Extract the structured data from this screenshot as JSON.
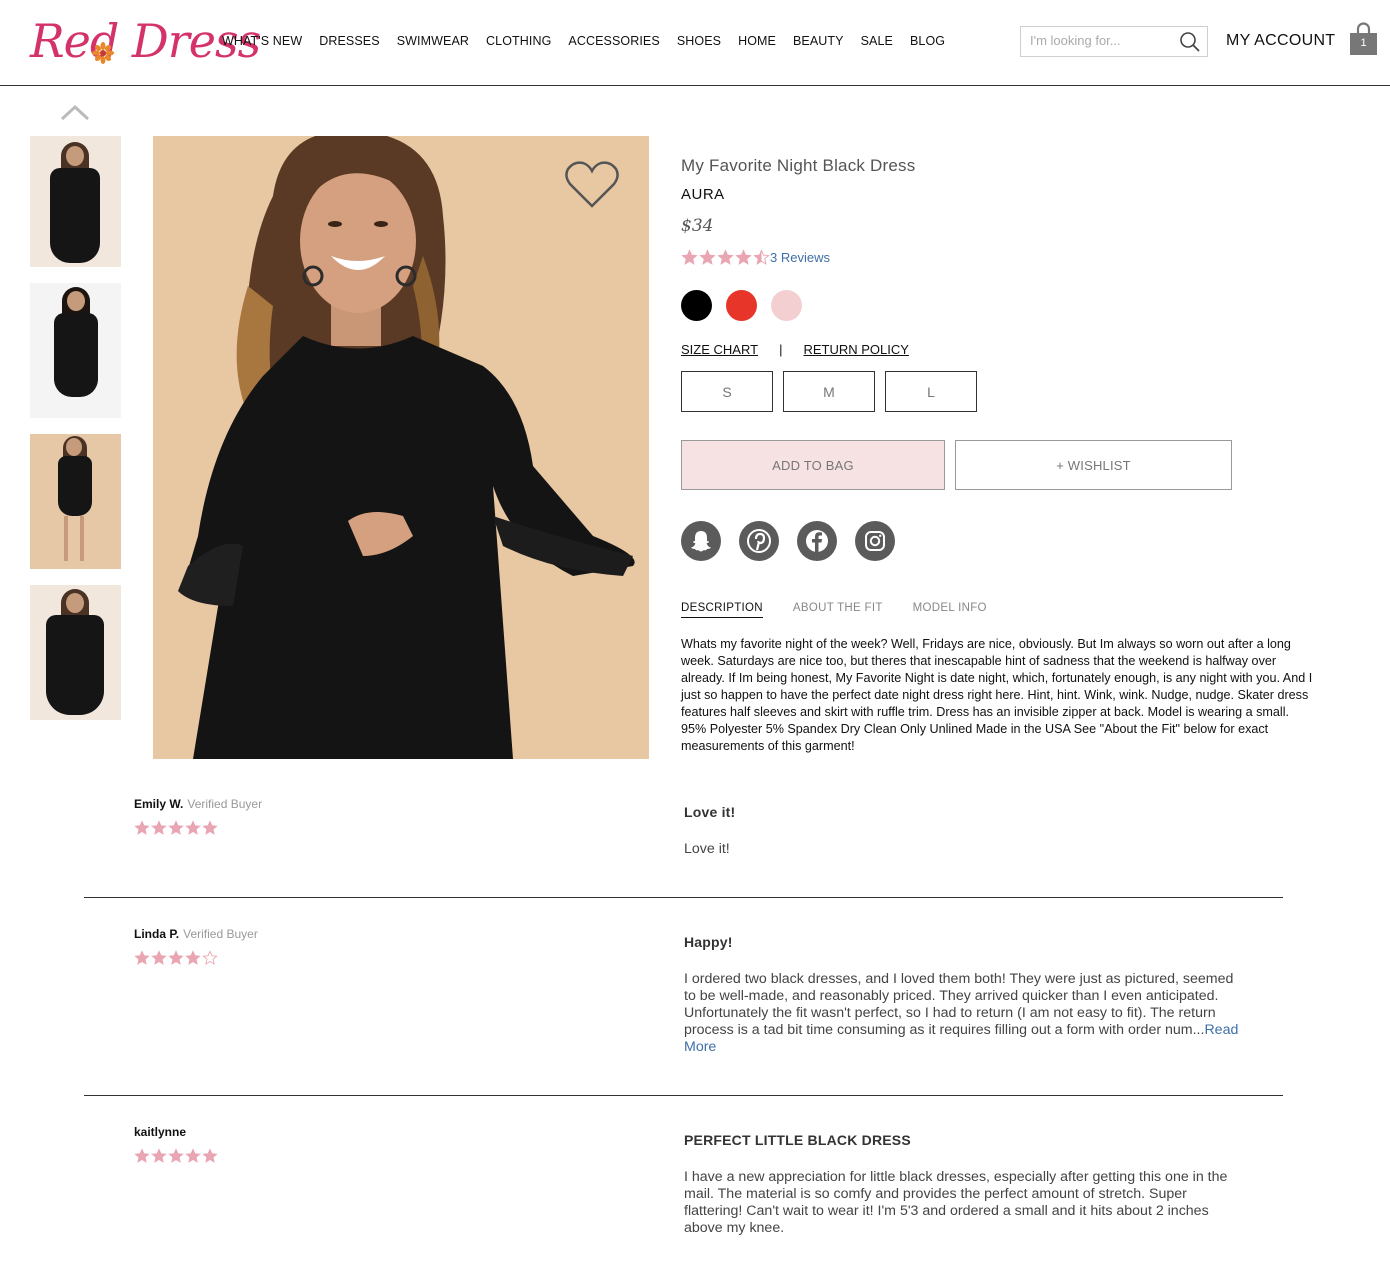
{
  "brand": {
    "logo_text": "Red Dress"
  },
  "nav": {
    "items": [
      "WHAT'S NEW",
      "DRESSES",
      "SWIMWEAR",
      "CLOTHING",
      "ACCESSORIES",
      "SHOES",
      "HOME",
      "BEAUTY",
      "SALE",
      "BLOG"
    ]
  },
  "search": {
    "placeholder": "I'm looking for...",
    "icon": "search-icon"
  },
  "account": {
    "label": "MY ACCOUNT",
    "bag_count": "1"
  },
  "product": {
    "title": "My Favorite Night Black Dress",
    "brand": "AURA",
    "price": "$34",
    "rating": 4.5,
    "reviews_label": "3 Reviews",
    "swatches": [
      "#000000",
      "#e8352a",
      "#f3cfd2"
    ],
    "size_chart": "SIZE CHART",
    "separator": "|",
    "return_policy": "RETURN POLICY",
    "sizes": [
      "S",
      "M",
      "L"
    ],
    "add_to_bag": "ADD TO BAG",
    "wishlist": "+ WISHLIST",
    "social": [
      "snapchat-icon",
      "pinterest-icon",
      "facebook-icon",
      "instagram-icon"
    ],
    "tabs": [
      "DESCRIPTION",
      "ABOUT THE FIT",
      "MODEL INFO"
    ],
    "description": "Whats my favorite night of the week? Well, Fridays are nice, obviously. But Im always so worn out after a long week. Saturdays are nice too, but theres that inescapable hint of sadness that the weekend is halfway over already. If Im being honest, My Favorite Night is date night, which, fortunately enough, is any night with you. And I just so happen to have the perfect date night dress right here. Hint, hint. Wink, wink. Nudge, nudge. Skater dress features half sleeves and skirt with ruffle trim. Dress has an invisible zipper at back. Model is wearing a small.  95% Polyester 5% Spandex  Dry Clean Only  Unlined  Made in the USA See \"About the Fit\" below for exact measurements of this garment!"
  },
  "reviews": [
    {
      "name": "Emily W.",
      "verified": "Verified Buyer",
      "stars": 5,
      "title": "Love it!",
      "body": "Love it!",
      "read_more": ""
    },
    {
      "name": "Linda P.",
      "verified": "Verified Buyer",
      "stars": 4,
      "title": "Happy!",
      "body": "I ordered two black dresses, and I loved them both! They were just as pictured, seemed to be well-made, and reasonably priced. They arrived quicker than I even anticipated. Unfortunately the fit wasn't perfect, so I had to return (I am not easy to fit). The return process is a tad bit time consuming as it requires filling out a form with order num...",
      "read_more": "Read More"
    },
    {
      "name": "kaitlynne",
      "verified": "",
      "stars": 5,
      "title": "PERFECT LITTLE BLACK DRESS",
      "body": "I have a new appreciation for little black dresses, especially after getting this one in the mail. The material is so comfy and provides the perfect amount of stretch. Super flattering! Can't wait to wear it! I'm 5'3 and ordered a small and it hits about 2 inches above my knee.",
      "read_more": ""
    }
  ],
  "colors": {
    "star": "#e9a6b2",
    "link": "#3f6fa8",
    "brand": "#d4326b",
    "bag_button": "#f6e1e3"
  }
}
